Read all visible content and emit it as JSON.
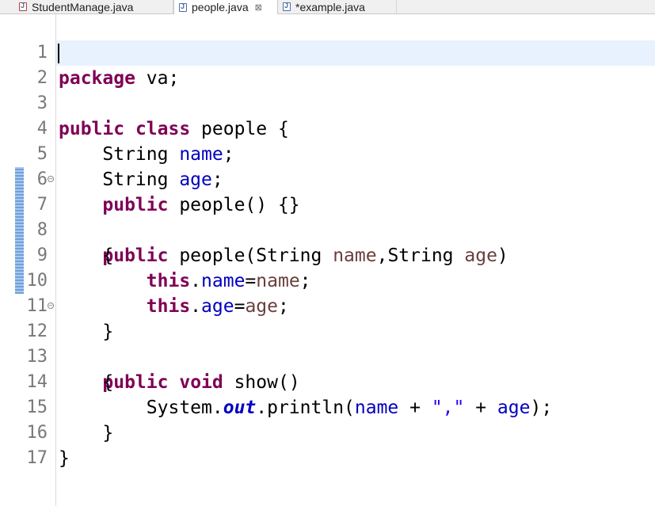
{
  "tabs": [
    {
      "label": "StudentManage.java",
      "active": false,
      "icon": "java-file-error-icon"
    },
    {
      "label": "people.java",
      "active": true,
      "icon": "java-file-icon",
      "close": "⊠"
    },
    {
      "label": "*example.java",
      "active": false,
      "icon": "java-file-icon"
    }
  ],
  "editor": {
    "current_line": 2,
    "lines": [
      {
        "n": "1",
        "fold": false
      },
      {
        "n": "2",
        "fold": false
      },
      {
        "n": "3",
        "fold": false
      },
      {
        "n": "4",
        "fold": false
      },
      {
        "n": "5",
        "fold": false
      },
      {
        "n": "6",
        "fold": false
      },
      {
        "n": "7",
        "fold": true
      },
      {
        "n": "8",
        "fold": false
      },
      {
        "n": "9",
        "fold": false
      },
      {
        "n": "10",
        "fold": false
      },
      {
        "n": "11",
        "fold": false
      },
      {
        "n": "12",
        "fold": true
      },
      {
        "n": "13",
        "fold": false
      },
      {
        "n": "14",
        "fold": false
      },
      {
        "n": "15",
        "fold": false
      },
      {
        "n": "16",
        "fold": false
      },
      {
        "n": "17",
        "fold": false
      }
    ],
    "tokens": {
      "l1": [
        "package",
        " va;"
      ],
      "l3": [
        "public",
        " ",
        "class",
        " people {"
      ],
      "l4": [
        "    String ",
        "name",
        ";"
      ],
      "l5": [
        "    String ",
        "age",
        ";"
      ],
      "l6": [
        "    ",
        "public",
        " people() {}"
      ],
      "l7": [
        "    ",
        "public",
        " people(String ",
        "name",
        ",String ",
        "age",
        ")"
      ],
      "l8": [
        "    {"
      ],
      "l9": [
        "        ",
        "this",
        ".",
        "name",
        "=",
        "name",
        ";"
      ],
      "l10": [
        "        ",
        "this",
        ".",
        "age",
        "=",
        "age",
        ";"
      ],
      "l11": [
        "    }"
      ],
      "l12": [
        "    ",
        "public",
        " ",
        "void",
        " show()"
      ],
      "l13": [
        "    {"
      ],
      "l14": [
        "        System.",
        "out",
        ".println(",
        "name",
        " + ",
        "\",\"",
        " + ",
        "age",
        ");"
      ],
      "l15": [
        "    }"
      ],
      "l16": [
        "}"
      ],
      "l17": [
        ""
      ]
    }
  },
  "colors": {
    "keyword": "#7f0055",
    "field": "#0000c0",
    "local_variable": "#6a3e3e",
    "string": "#2a00ff",
    "current_line_bg": "#e8f2fe",
    "change_bar": "#6fa0d8"
  }
}
